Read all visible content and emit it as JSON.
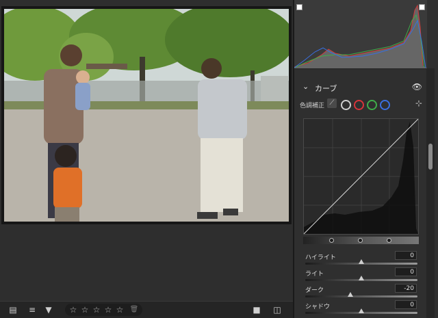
{
  "toolbar": {
    "icons": [
      "filmstrip-icon",
      "sort-icon",
      "filter-icon",
      "trash-icon",
      "color-label-icon",
      "compare-icon"
    ],
    "rating_stars": [
      "☆",
      "☆",
      "☆",
      "☆",
      "☆"
    ],
    "trash_glyph": "🗑"
  },
  "curve_panel": {
    "title": "カーブ",
    "collapse_glyph": "⌄",
    "eye_glyph": "👁",
    "channel_label": "色調補正",
    "channels": [
      {
        "name": "rgb",
        "color": "#d0d0d0"
      },
      {
        "name": "red",
        "color": "#d8343a"
      },
      {
        "name": "green",
        "color": "#3fae4a"
      },
      {
        "name": "blue",
        "color": "#3a6fe0"
      }
    ],
    "target_glyph": "⊹"
  },
  "sliders": [
    {
      "label": "ハイライト",
      "value": "0",
      "level": 0.5
    },
    {
      "label": "ライト",
      "value": "0",
      "level": 0.5
    },
    {
      "label": "ダーク",
      "value": "-20",
      "level": 0.4
    },
    {
      "label": "シャドウ",
      "value": "0",
      "level": 0.5
    }
  ],
  "colors": {
    "panel_bg": "#2f2f2f",
    "histogram_red": "#d33b3b",
    "histogram_green": "#3fae4a",
    "histogram_blue": "#3a6fe0"
  }
}
